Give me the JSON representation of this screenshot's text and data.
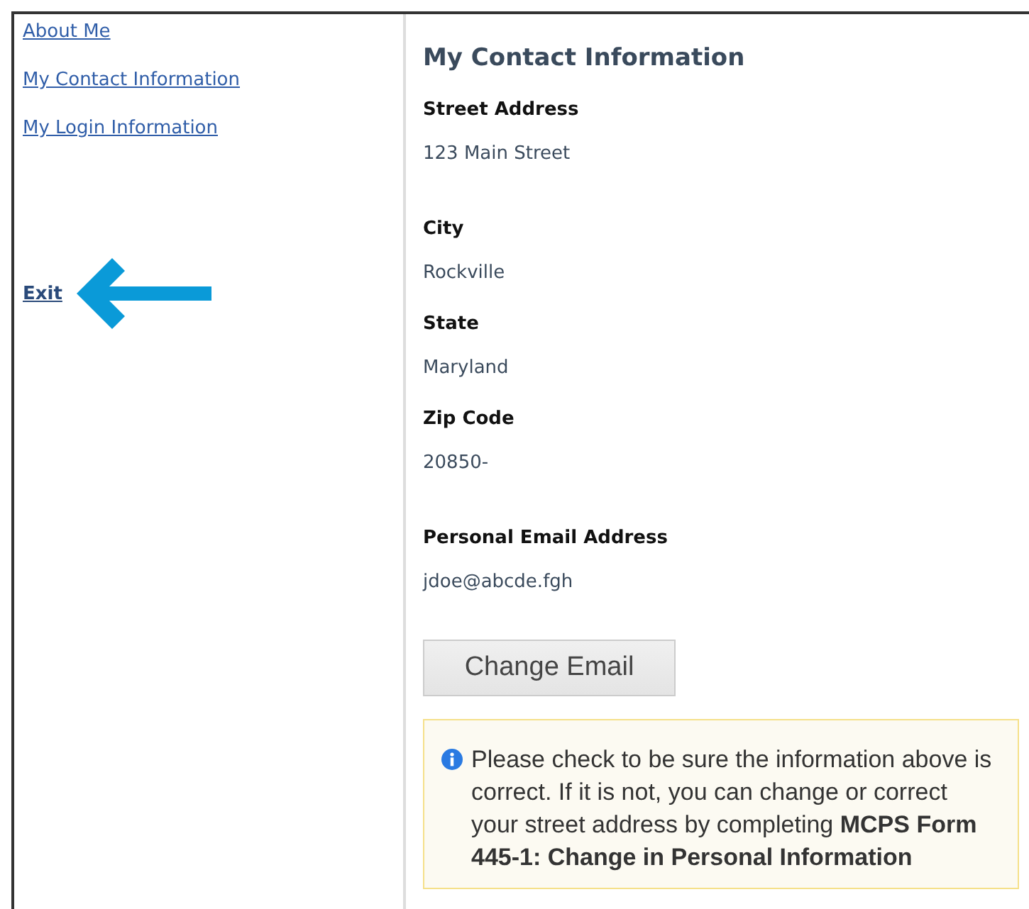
{
  "sidebar": {
    "items": [
      {
        "label": "About Me"
      },
      {
        "label": "My Contact Information"
      },
      {
        "label": "My Login Information"
      }
    ],
    "exit": {
      "label": "Exit"
    }
  },
  "main": {
    "title": "My Contact Information",
    "fields": [
      {
        "label": "Street Address",
        "value": "123 Main Street"
      },
      {
        "label": "City",
        "value": "Rockville"
      },
      {
        "label": "State",
        "value": "Maryland"
      },
      {
        "label": "Zip Code",
        "value": "20850-"
      },
      {
        "label": "Personal Email Address",
        "value": "jdoe@abcde.fgh"
      }
    ],
    "button": "Change Email",
    "notice": "Please check to be sure the information above is correct. If it is not, you can change or correct your street address by completing **MCPS Form 445-1: Change in Personal Information**"
  }
}
